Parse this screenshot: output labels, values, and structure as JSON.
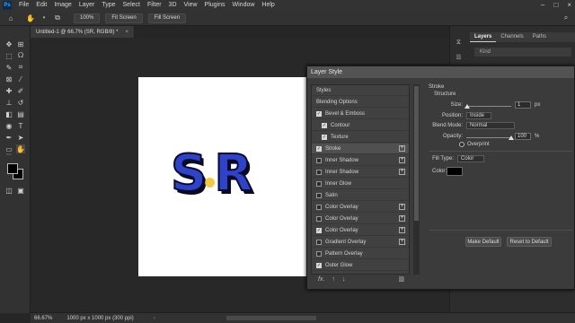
{
  "menubar": {
    "logo": "Ps",
    "items": [
      "File",
      "Edit",
      "Image",
      "Layer",
      "Type",
      "Select",
      "Filter",
      "3D",
      "View",
      "Plugins",
      "Window",
      "Help"
    ],
    "window_controls": [
      "–",
      "□",
      "×"
    ]
  },
  "options": {
    "zoom_label": "100%",
    "fit_screen_label": "Fit Screen",
    "fill_screen_label": "Fill Screen"
  },
  "document": {
    "tab_title": "Untitled-1 @ 66.7% (SR, RGB/8) *",
    "close": "×",
    "canvas_text": "SR"
  },
  "status": {
    "zoom": "66.67%",
    "doc_info": "1000 px x 1000 px (300 ppi)"
  },
  "panels": {
    "tabs": [
      "Layers",
      "Channels",
      "Paths"
    ],
    "search_placeholder": "Kind"
  },
  "dialog": {
    "title": "Layer Style",
    "styles": [
      {
        "label": "Styles",
        "checkbox": false,
        "checked": false,
        "plus": false
      },
      {
        "label": "Blending Options",
        "checkbox": false,
        "checked": false,
        "plus": false
      },
      {
        "label": "Bevel & Emboss",
        "checkbox": true,
        "checked": true,
        "plus": false
      },
      {
        "label": "Contour",
        "checkbox": true,
        "checked": true,
        "plus": false,
        "indent": true
      },
      {
        "label": "Texture",
        "checkbox": true,
        "checked": true,
        "plus": false,
        "indent": true
      },
      {
        "label": "Stroke",
        "checkbox": true,
        "checked": true,
        "plus": true,
        "selected": true
      },
      {
        "label": "Inner Shadow",
        "checkbox": true,
        "checked": false,
        "plus": true
      },
      {
        "label": "Inner Shadow",
        "checkbox": true,
        "checked": false,
        "plus": true
      },
      {
        "label": "Inner Glow",
        "checkbox": true,
        "checked": false,
        "plus": false
      },
      {
        "label": "Satin",
        "checkbox": true,
        "checked": false,
        "plus": false
      },
      {
        "label": "Color Overlay",
        "checkbox": true,
        "checked": false,
        "plus": true
      },
      {
        "label": "Color Overlay",
        "checkbox": true,
        "checked": false,
        "plus": true
      },
      {
        "label": "Color Overlay",
        "checkbox": true,
        "checked": true,
        "plus": true
      },
      {
        "label": "Gradient Overlay",
        "checkbox": true,
        "checked": false,
        "plus": true
      },
      {
        "label": "Pattern Overlay",
        "checkbox": true,
        "checked": false,
        "plus": false
      },
      {
        "label": "Outer Glow",
        "checkbox": true,
        "checked": true,
        "plus": false
      }
    ],
    "footer": {
      "fx": "fx.",
      "up": "↑",
      "down": "↓",
      "trash": "🗑"
    },
    "stroke": {
      "group_title": "Stroke",
      "sub_title": "Structure",
      "size_label": "Size:",
      "size_value": "1",
      "size_unit": "px",
      "size_fraction": 0.02,
      "position_label": "Position:",
      "position_value": "Inside",
      "blend_label": "Blend Mode:",
      "blend_value": "Normal",
      "opacity_label": "Opacity:",
      "opacity_value": "100",
      "opacity_unit": "%",
      "opacity_fraction": 1.0,
      "overprint_label": "Overprint",
      "fill_type_label": "Fill Type:",
      "fill_type_value": "Color",
      "color_label": "Color:",
      "color_value": "#000000"
    },
    "make_default": "Make Default",
    "reset_default": "Reset to Default"
  }
}
